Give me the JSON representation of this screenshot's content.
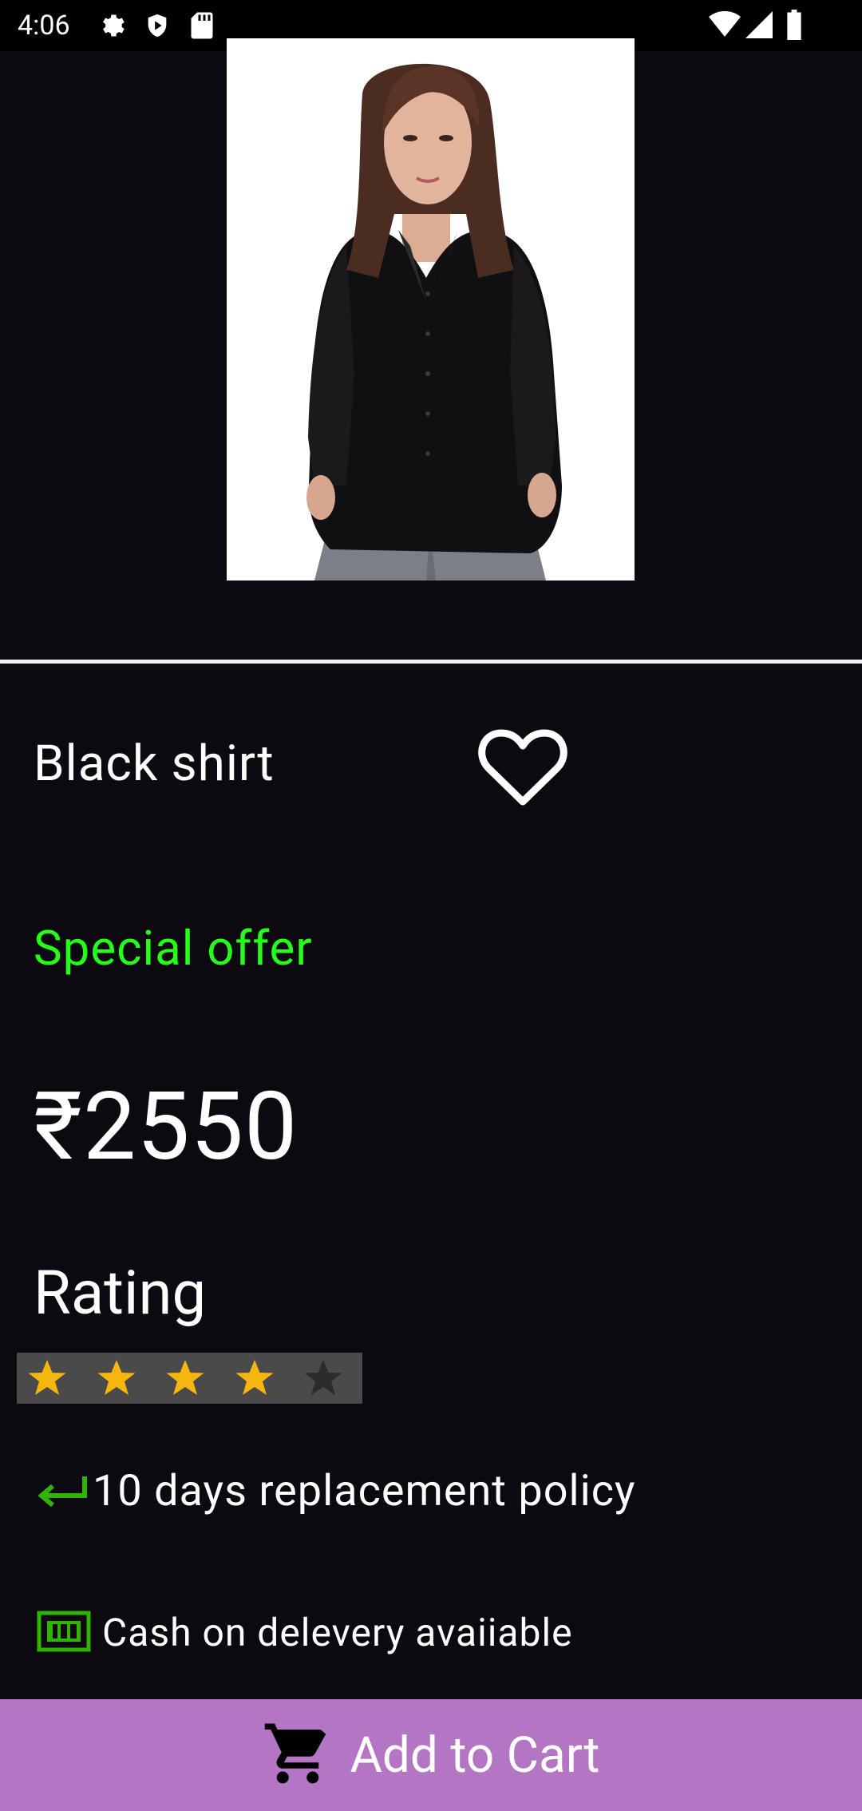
{
  "status_bar": {
    "time": "4:06"
  },
  "product": {
    "name": "Black shirt",
    "offer_label": "Special offer",
    "price": "₹2550",
    "rating_label": "Rating",
    "rating_value": 4,
    "rating_max": 5
  },
  "features": {
    "replacement_policy": "10 days replacement policy",
    "cash_on_delivery": "Cash on delevery avaiiable"
  },
  "actions": {
    "add_to_cart_label": "Add to Cart"
  },
  "colors": {
    "background": "#0c0a10",
    "offer_green": "#25ff1b",
    "star_gold": "#f5b70f",
    "cart_button": "#b476c4",
    "feature_icon_green": "#2fb500"
  }
}
